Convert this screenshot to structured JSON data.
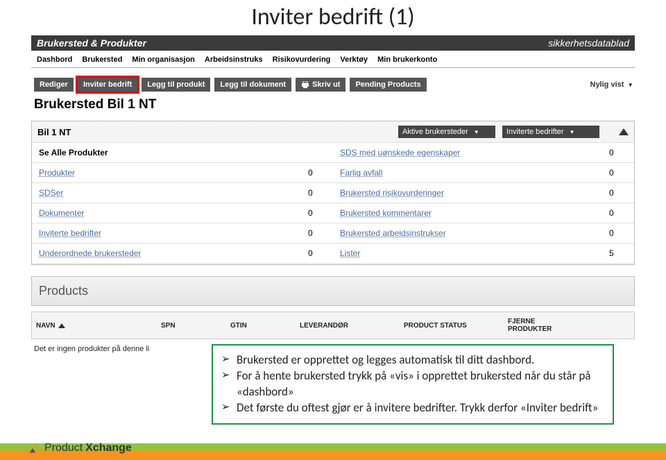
{
  "slide_title": "Inviter bedrift (1)",
  "header": {
    "left": "Brukersted & Produkter",
    "right": "sikkerhetsdatablad"
  },
  "nav": [
    "Dashbord",
    "Brukersted",
    "Min organisasjon",
    "Arbeidsinstruks",
    "Risikovurdering",
    "Verktøy",
    "Min brukerkonto"
  ],
  "toolbar": {
    "rediger": "Rediger",
    "inviter": "Inviter bedrift",
    "legg_produkt": "Legg til produkt",
    "legg_dokument": "Legg til dokument",
    "skriv_ut": "Skriv ut",
    "pending": "Pending Products",
    "nylig": "Nylig vist"
  },
  "page_title": "Brukersted Bil 1 NT",
  "panel": {
    "title": "Bil 1 NT",
    "select1": "Aktive brukersteder",
    "select2": "Inviterte bedrifter",
    "left_rows": [
      {
        "label": "Se Alle Produkter",
        "val": "",
        "head": true
      },
      {
        "label": "Produkter",
        "val": "0"
      },
      {
        "label": "SDSer",
        "val": "0"
      },
      {
        "label": "Dokumenter",
        "val": "0"
      },
      {
        "label": "Inviterte bedrifter",
        "val": "0"
      },
      {
        "label": "Underordnede brukersteder",
        "val": "0"
      }
    ],
    "right_rows": [
      {
        "label": "SDS med uønskede egenskaper",
        "val": "0"
      },
      {
        "label": "Farlig avfall",
        "val": "0"
      },
      {
        "label": "Brukersted risikovurderinger",
        "val": "0"
      },
      {
        "label": "Brukersted kommentarer",
        "val": "0"
      },
      {
        "label": "Brukersted arbeidsinstrukser",
        "val": "0"
      },
      {
        "label": "Lister",
        "val": "5"
      }
    ]
  },
  "products": {
    "heading": "Products",
    "cols": [
      "NAVN",
      "SPN",
      "GTIN",
      "LEVERANDØR",
      "PRODUCT STATUS",
      "FJERNE PRODUKTER"
    ],
    "empty": "Det er ingen produkter på denne li"
  },
  "overlay": [
    "Brukersted er opprettet og legges automatisk til ditt dashbord.",
    "For å hente brukersted trykk på «vis» i opprettet brukersted når du står på «dashbord»",
    "Det første du oftest gjør er å invitere bedrifter. Trykk derfor «Inviter bedrift»"
  ],
  "footer_brand": {
    "a": "Product",
    "b": "Xchange"
  }
}
